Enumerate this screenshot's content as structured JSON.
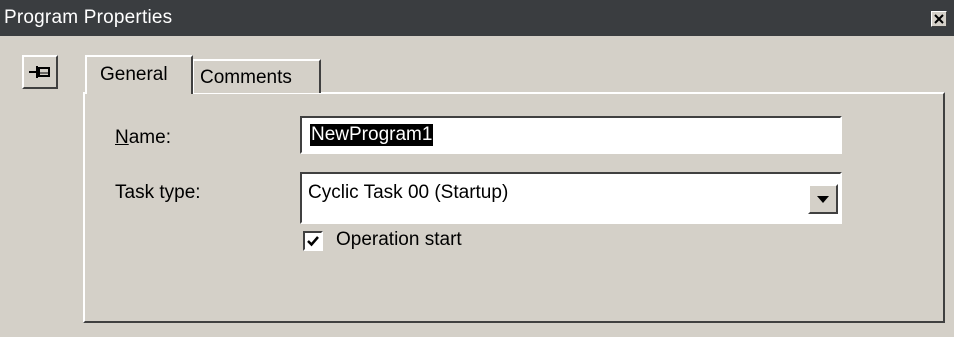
{
  "window": {
    "title": "Program Properties",
    "close_icon": "close-icon"
  },
  "toolbar": {
    "pin_icon": "pushpin-icon"
  },
  "tabs": [
    {
      "label": "General",
      "active": true
    },
    {
      "label": "Comments",
      "active": false
    }
  ],
  "form": {
    "name_label_mnemonic": "N",
    "name_label_rest": "ame:",
    "name_value": "NewProgram1",
    "task_type_label": "Task type:",
    "task_type_value": "Cyclic Task 00 (Startup)",
    "operation_start_label": "Operation start",
    "operation_start_checked": true
  },
  "colors": {
    "titlebar": "#3a3d40",
    "face": "#d4d0c8",
    "selection": "#000000"
  }
}
